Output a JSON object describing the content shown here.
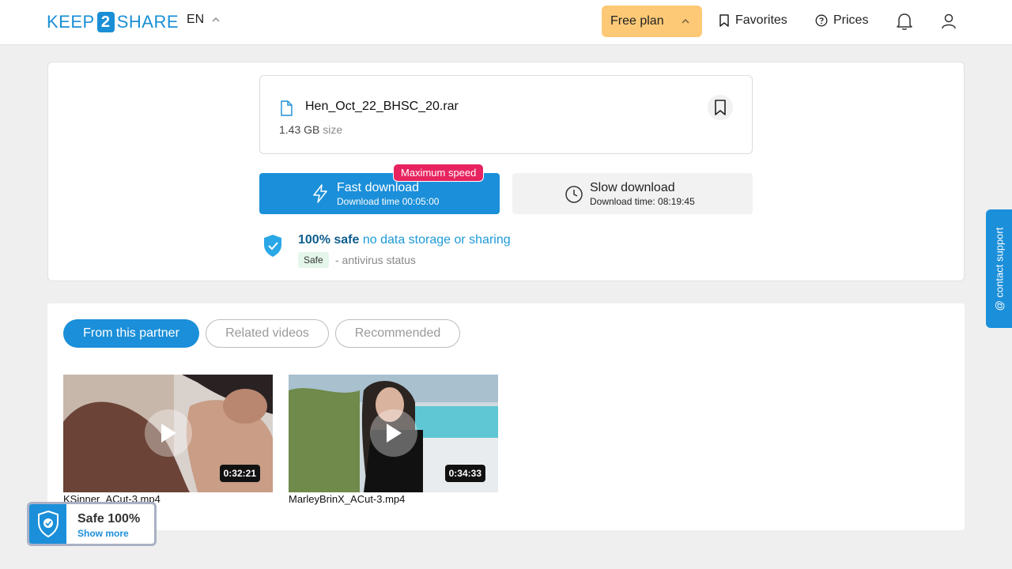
{
  "header": {
    "logo": {
      "left": "KEEP",
      "middle": "2",
      "right": "SHARE"
    },
    "language": "EN",
    "plan_label": "Free plan",
    "favorites_label": "Favorites",
    "prices_label": "Prices"
  },
  "file": {
    "name": "Hen_Oct_22_BHSC_20.rar",
    "size_value": "1.43 GB",
    "size_unit": "size"
  },
  "download": {
    "fast": {
      "title": "Fast download",
      "time": "Download time 00:05:00",
      "badge": "Maximum speed"
    },
    "slow": {
      "title": "Slow download",
      "time": "Download time: 08:19:45"
    }
  },
  "safety": {
    "strong": "100% safe",
    "rest": " no data storage or sharing",
    "tag": "Safe",
    "antivirus": "- antivirus status"
  },
  "tabs": [
    {
      "label": "From this partner",
      "active": true
    },
    {
      "label": "Related videos",
      "active": false
    },
    {
      "label": "Recommended",
      "active": false
    }
  ],
  "videos": [
    {
      "name": "KSinner_ACut-3.mp4",
      "duration": "0:32:21"
    },
    {
      "name": "MarleyBrinX_ACut-3.mp4",
      "duration": "0:34:33"
    }
  ],
  "safe_widget": {
    "title": "Safe 100%",
    "link": "Show more"
  },
  "support_label": "@ contact support",
  "colors": {
    "accent": "#1b8fd9",
    "plan_bg": "#fdc977",
    "badge": "#e7245f",
    "safe_tag_bg": "#e4f6ea"
  }
}
